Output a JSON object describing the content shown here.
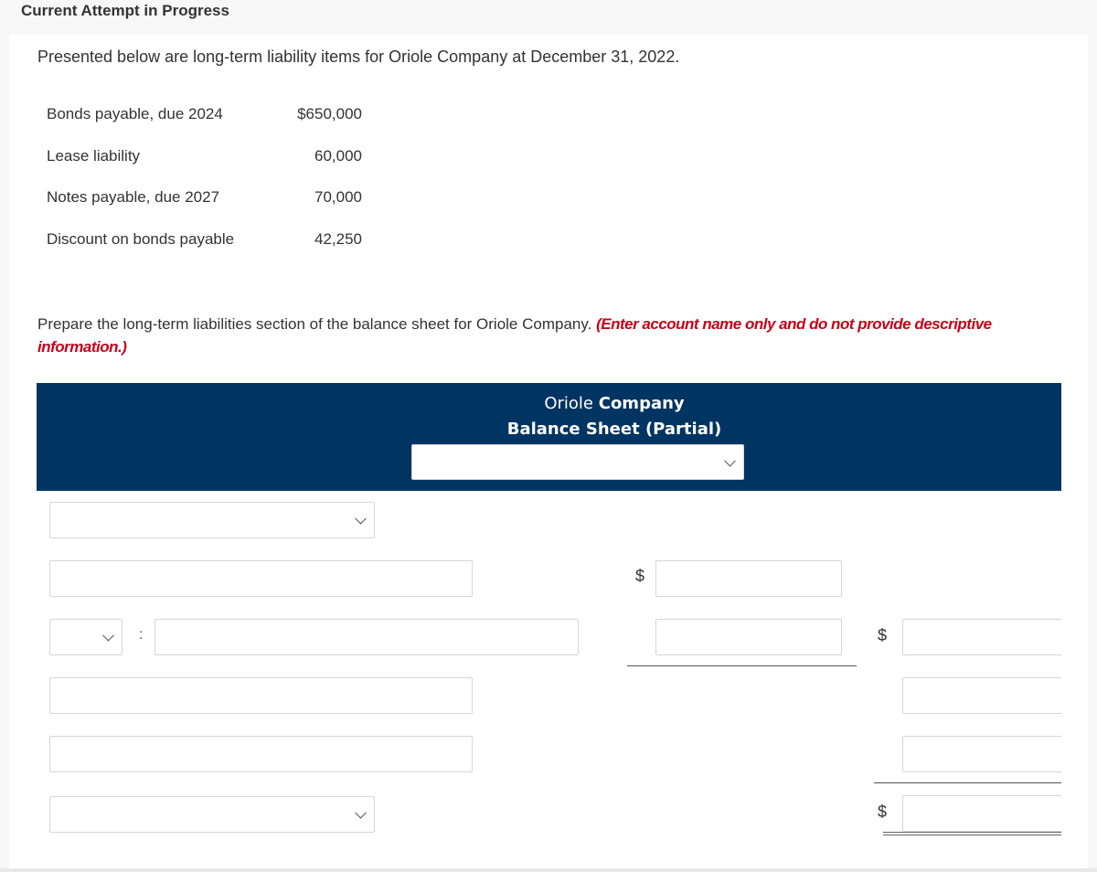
{
  "page": {
    "attempt_label": "Current Attempt in Progress",
    "intro": "Presented below are long-term liability items for Oriole Company at December 31, 2022."
  },
  "items": [
    {
      "label": "Bonds payable, due 2024",
      "value": "$650,000"
    },
    {
      "label": "Lease liability",
      "value": "60,000"
    },
    {
      "label": "Notes payable, due 2027",
      "value": "70,000"
    },
    {
      "label": "Discount on bonds payable",
      "value": "42,250"
    }
  ],
  "instructions": {
    "text": "Prepare the long-term liabilities section of the balance sheet for Oriole Company.",
    "note": "(Enter account name only and do not provide descriptive information.)"
  },
  "statement": {
    "company_first": "Oriole",
    "company_second": "Company",
    "title": "Balance Sheet (Partial)",
    "date_select_value": ""
  },
  "form": {
    "currency_symbol": "$",
    "colon": ":",
    "section_select_value": "",
    "row1_account": "",
    "row1_amount": "",
    "row2_prefix_select": "",
    "row2_account": "",
    "row2_amount": "",
    "row2_total": "",
    "row3_account": "",
    "row3_total": "",
    "row4_account": "",
    "row4_total": "",
    "total_select_value": "",
    "grand_total": ""
  },
  "colors": {
    "header_bg": "#003462",
    "note_red": "#c4001a"
  }
}
